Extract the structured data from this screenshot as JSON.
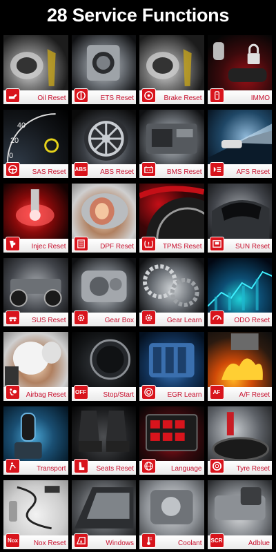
{
  "title": "28 Service Functions",
  "functions": [
    {
      "label": "Oil Reset",
      "icon": "oil-can-icon"
    },
    {
      "label": "ETS Reset",
      "icon": "throttle-icon"
    },
    {
      "label": "Brake Reset",
      "icon": "brake-disc-icon"
    },
    {
      "label": "IMMO",
      "icon": "key-icon"
    },
    {
      "label": "SAS Reset",
      "icon": "steering-wheel-icon"
    },
    {
      "label": "ABS Reset",
      "icon": "abs-icon",
      "badge_text": "ABS"
    },
    {
      "label": "BMS Reset",
      "icon": "battery-icon"
    },
    {
      "label": "AFS Reset",
      "icon": "headlight-icon"
    },
    {
      "label": "Injec Reset",
      "icon": "injector-icon"
    },
    {
      "label": "DPF Reset",
      "icon": "filter-icon"
    },
    {
      "label": "TPMS Reset",
      "icon": "tire-pressure-icon"
    },
    {
      "label": "SUN Reset",
      "icon": "sunroof-icon"
    },
    {
      "label": "SUS Reset",
      "icon": "suspension-icon"
    },
    {
      "label": "Gear Box",
      "icon": "gear-icon"
    },
    {
      "label": "Gear Learn",
      "icon": "gear-icon"
    },
    {
      "label": "ODO Reset",
      "icon": "odometer-icon"
    },
    {
      "label": "Airbag Reset",
      "icon": "airbag-icon"
    },
    {
      "label": "Stop/Start",
      "icon": "auto-start-stop-icon",
      "badge_text": "OFF"
    },
    {
      "label": "EGR Learn",
      "icon": "egr-icon"
    },
    {
      "label": "A/F Reset",
      "icon": "air-fuel-icon",
      "badge_text": "AF"
    },
    {
      "label": "Transport",
      "icon": "transport-mode-icon"
    },
    {
      "label": "Seats Reset",
      "icon": "seat-icon"
    },
    {
      "label": "Language",
      "icon": "globe-icon"
    },
    {
      "label": "Tyre Reset",
      "icon": "tyre-icon"
    },
    {
      "label": "Nox Reset",
      "icon": "nox-sensor-icon",
      "badge_text": "Nox"
    },
    {
      "label": "Windows",
      "icon": "window-icon"
    },
    {
      "label": "Coolant",
      "icon": "thermometer-icon"
    },
    {
      "label": "Adblue",
      "icon": "scr-icon",
      "badge_text": "SCR"
    }
  ],
  "colors": {
    "background": "#000000",
    "label": "#c8102e",
    "badge": "#d8141c",
    "bar": "#ffffff"
  }
}
